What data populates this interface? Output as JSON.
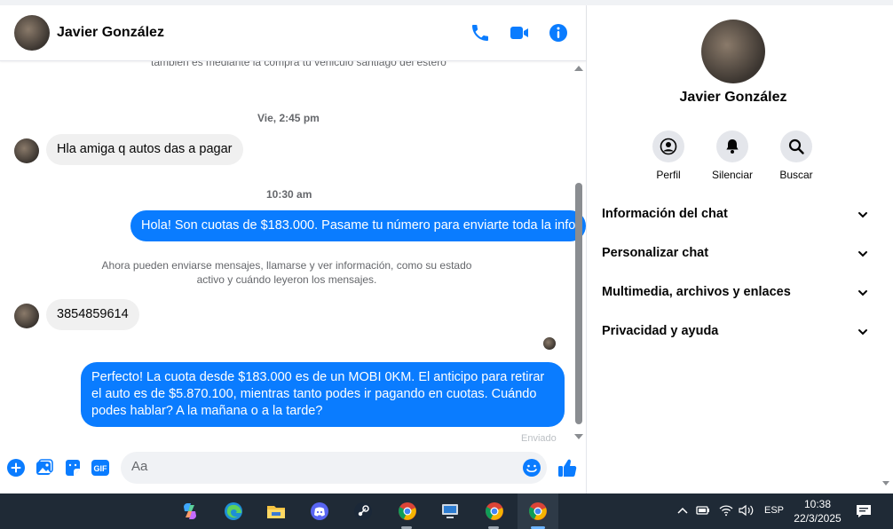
{
  "header": {
    "contact_name": "Javier González",
    "call_icon": "phone-icon",
    "video_icon": "video-camera-icon",
    "info_icon": "info-icon"
  },
  "conversation": {
    "cut_text": "también es mediante la compra tu vehiculo santiago del estero",
    "timestamps": [
      "Vie, 2:45 pm",
      "10:30 am"
    ],
    "messages": [
      {
        "direction": "in",
        "text": "Hla amiga q autos das a pagar"
      },
      {
        "direction": "out",
        "text": "Hola! Son cuotas de $183.000. Pasame tu número para enviarte toda la info"
      },
      {
        "direction": "in",
        "text": "3854859614"
      },
      {
        "direction": "out",
        "text": "Perfecto! La cuota desde $183.000 es de un MOBI 0KM. El anticipo para retirar el auto es de $5.870.100, mientras tanto podes ir pagando en cuotas. Cuándo podes hablar? A la mañana o a la tarde?"
      }
    ],
    "notice": "Ahora pueden enviarse mensajes, llamarse y ver información, como su estado activo y cuándo leyeron los mensajes.",
    "sent_label": "Enviado"
  },
  "composer": {
    "placeholder": "Aa",
    "value": "",
    "icons": [
      "plus-icon",
      "image-icon",
      "sticker-icon",
      "gif-icon",
      "emoji-icon",
      "thumbs-up-icon"
    ],
    "gif_label": "GIF"
  },
  "info_panel": {
    "name": "Javier González",
    "actions": [
      {
        "label": "Perfil",
        "icon": "profile-icon"
      },
      {
        "label": "Silenciar",
        "icon": "bell-icon"
      },
      {
        "label": "Buscar",
        "icon": "search-icon"
      }
    ],
    "sections": [
      "Información del chat",
      "Personalizar chat",
      "Multimedia, archivos y enlaces",
      "Privacidad y ayuda"
    ]
  },
  "taskbar": {
    "apps": [
      "copilot",
      "edge",
      "file-explorer",
      "discord",
      "steam",
      "chrome",
      "remote-desktop",
      "chrome-profile",
      "chrome-active"
    ],
    "language": "ESP",
    "time": "10:38",
    "date": "22/3/2025"
  },
  "colors": {
    "accent": "#0a7cff",
    "incoming_bubble": "#f0f0f0",
    "taskbar": "#1f2a36"
  }
}
